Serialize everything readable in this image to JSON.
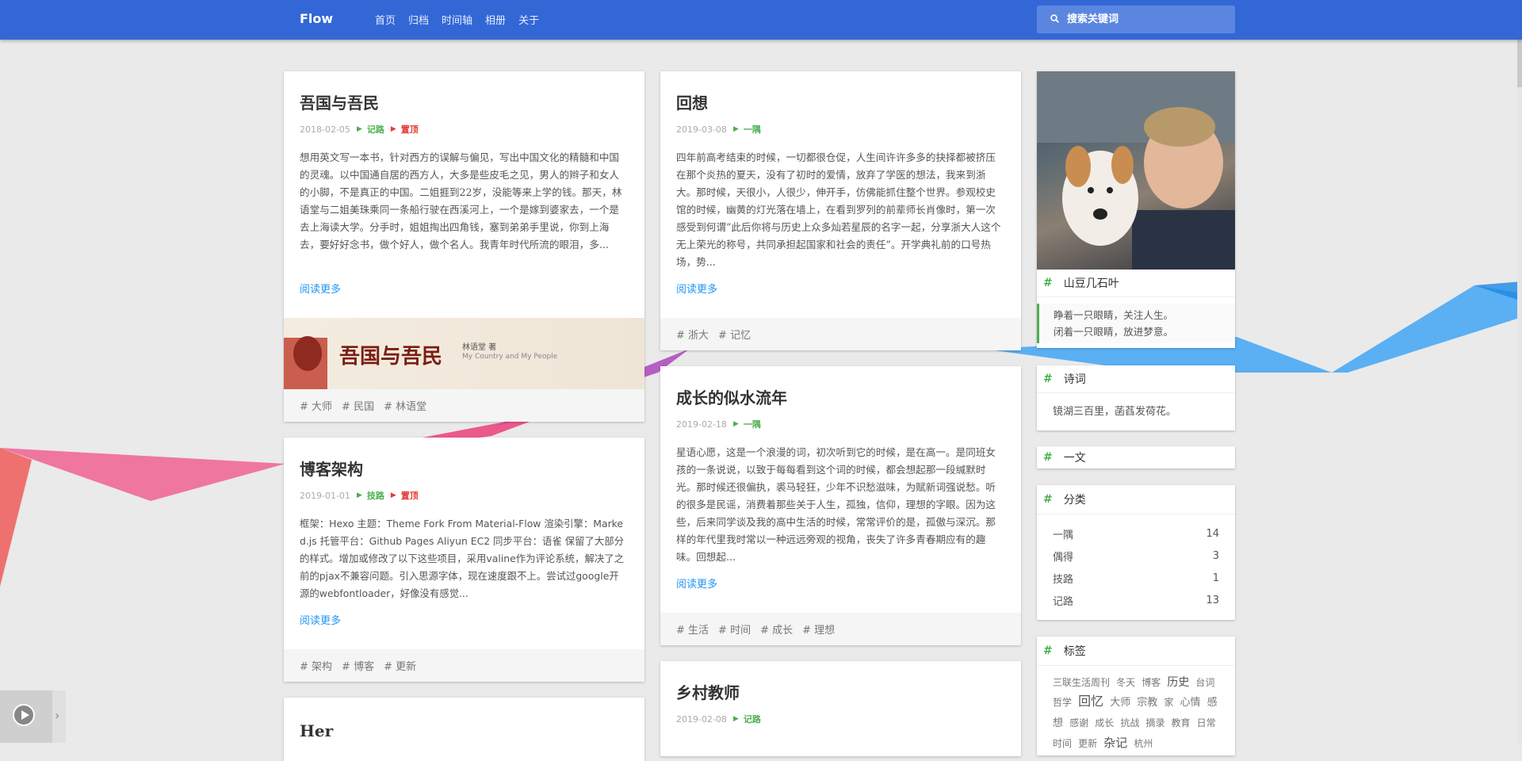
{
  "header": {
    "brand": "Flow",
    "nav": [
      "首页",
      "归档",
      "时间轴",
      "相册",
      "关于"
    ],
    "search_placeholder": "搜索关键词"
  },
  "posts_left": [
    {
      "title": "吾国与吾民",
      "date": "2018-02-05",
      "category": "记路",
      "sticky": "置顶",
      "excerpt": "想用英文写一本书，针对西方的误解与偏见，写出中国文化的精髓和中国的灵魂。以中国通自居的西方人，大多是些皮毛之见，男人的辫子和女人的小脚，不是真正的中国。二姐捱到22岁，没能等来上学的钱。那天，林语堂与二姐美珠乘同一条船行驶在西溪河上，一个是嫁到婆家去，一个是去上海读大学。分手时，姐姐掏出四角钱，塞到弟弟手里说，你到上海去，要好好念书，做个好人，做个名人。我青年时代所流的眼泪，多...",
      "read_more": "阅读更多",
      "cover_text": "吾国与吾民",
      "cover_author": "林语堂 著",
      "cover_sub": "My Country and My People",
      "tags": [
        "大师",
        "民国",
        "林语堂"
      ]
    },
    {
      "title": "博客架构",
      "date": "2019-01-01",
      "category": "技路",
      "sticky": "置顶",
      "excerpt": "框架：Hexo 主题：Theme Fork From Material-Flow 渲染引擎：Marked.js 托管平台：Github Pages Aliyun EC2 同步平台：语雀 保留了大部分的样式。增加或修改了以下这些项目，采用valine作为评论系统，解决了之前的pjax不兼容问题。引入思源字体，现在速度跟不上。尝试过google开源的webfontloader，好像没有感觉...",
      "read_more": "阅读更多",
      "tags": [
        "架构",
        "博客",
        "更新"
      ]
    },
    {
      "title": "Her"
    }
  ],
  "posts_right": [
    {
      "title": "回想",
      "date": "2019-03-08",
      "category": "一隅",
      "excerpt": "四年前高考结束的时候，一切都很仓促，人生间许许多多的抉择都被挤压在那个炎热的夏天，没有了初时的爱情，放弃了学医的想法，我来到浙大。那时候，天很小，人很少，伸开手，仿佛能抓住整个世界。参观校史馆的时候，幽黄的灯光落在墙上，在看到罗列的前辈师长肖像时，第一次感受到何谓“此后你将与历史上众多灿若星辰的名字一起，分享浙大人这个无上荣光的称号，共同承担起国家和社会的责任”。开学典礼前的口号热场，势...",
      "read_more": "阅读更多",
      "tags": [
        "浙大",
        "记忆"
      ]
    },
    {
      "title": "成长的似水流年",
      "date": "2019-02-18",
      "category": "一隅",
      "excerpt": "星语心愿，这是一个浪漫的词，初次听到它的时候，是在高一。是同班女孩的一条说说，以致于每每看到这个词的时候，都会想起那一段缄默时光。那时候还很偏执，裘马轻狂，少年不识愁滋味，为赋新词强说愁。听的很多是民谣，消费着那些关于人生，孤独，信仰，理想的字眼。因为这些，后来同学谈及我的高中生活的时候，常常评价的是，孤傲与深沉。那样的年代里我时常以一种远远旁观的视角，丧失了许多青春期应有的趣味。回想起...",
      "read_more": "阅读更多",
      "tags": [
        "生活",
        "时间",
        "成长",
        "理想"
      ]
    },
    {
      "title": "乡村教师",
      "date": "2019-02-08",
      "category": "记路"
    }
  ],
  "sidebar": {
    "profile_name": "山豆几石叶",
    "motto_1": "睁着一只眼睛，关注人生。",
    "motto_2": "闭着一只眼睛，放进梦意。",
    "poem_title": "诗词",
    "poem_text": "镜湖三百里，菡萏发荷花。",
    "article_title": "一文",
    "category_title": "分类",
    "categories": [
      {
        "name": "一隅",
        "count": "14"
      },
      {
        "name": "偶得",
        "count": "3"
      },
      {
        "name": "技路",
        "count": "1"
      },
      {
        "name": "记路",
        "count": "13"
      }
    ],
    "tags_title": "标签",
    "tag_cloud": [
      "三联生活周刊",
      "冬天",
      "博客",
      "历史",
      "台词",
      "哲学",
      "回忆",
      "大师",
      "宗教",
      "家",
      "心情",
      "感想",
      "感谢",
      "成长",
      "抗战",
      "摘录",
      "教育",
      "日常",
      "时间",
      "更新",
      "杂记",
      "杭州"
    ]
  },
  "colors": {
    "header": "#3367d6",
    "accent_green": "#4caf50",
    "accent_red": "#e53935",
    "link": "#2196f3"
  }
}
